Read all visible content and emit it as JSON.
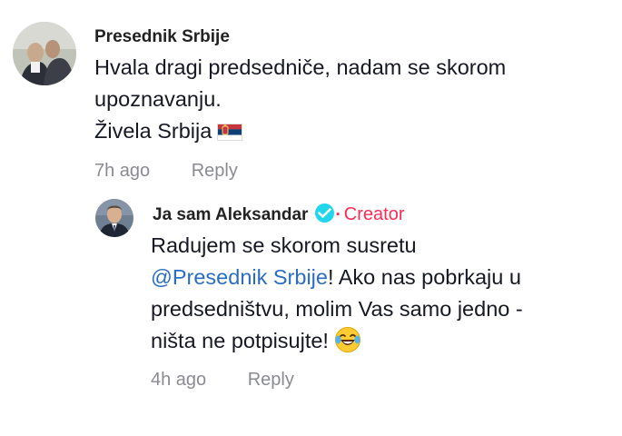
{
  "comments": [
    {
      "author": "Presednik Srbije",
      "lines": [
        "Hvala dragi predsedniče, nadam se skorom",
        "upoznavanju.",
        "Živela Srbija"
      ],
      "flag_icon": "serbia-flag-icon",
      "time": "7h ago",
      "reply_label": "Reply"
    }
  ],
  "reply": {
    "author": "Ja sam Aleksandar",
    "badge_icon": "verified-check-icon",
    "badge_color": "#20d5ec",
    "separator": "·",
    "role": "Creator",
    "role_color": "#fe2c55",
    "line1": "Radujem se skorom susretu",
    "mention": "@Presednik Srbije",
    "line2_rest": "! Ako nas pobrkaju u",
    "line3": "predsedništvu, molim Vas samo jedno -",
    "line4": "ništa ne potpisujte!",
    "emoji_icon": "laughing-tears-emoji-icon",
    "time": "4h ago",
    "reply_label": "Reply",
    "mention_color": "#2b6cc4"
  }
}
